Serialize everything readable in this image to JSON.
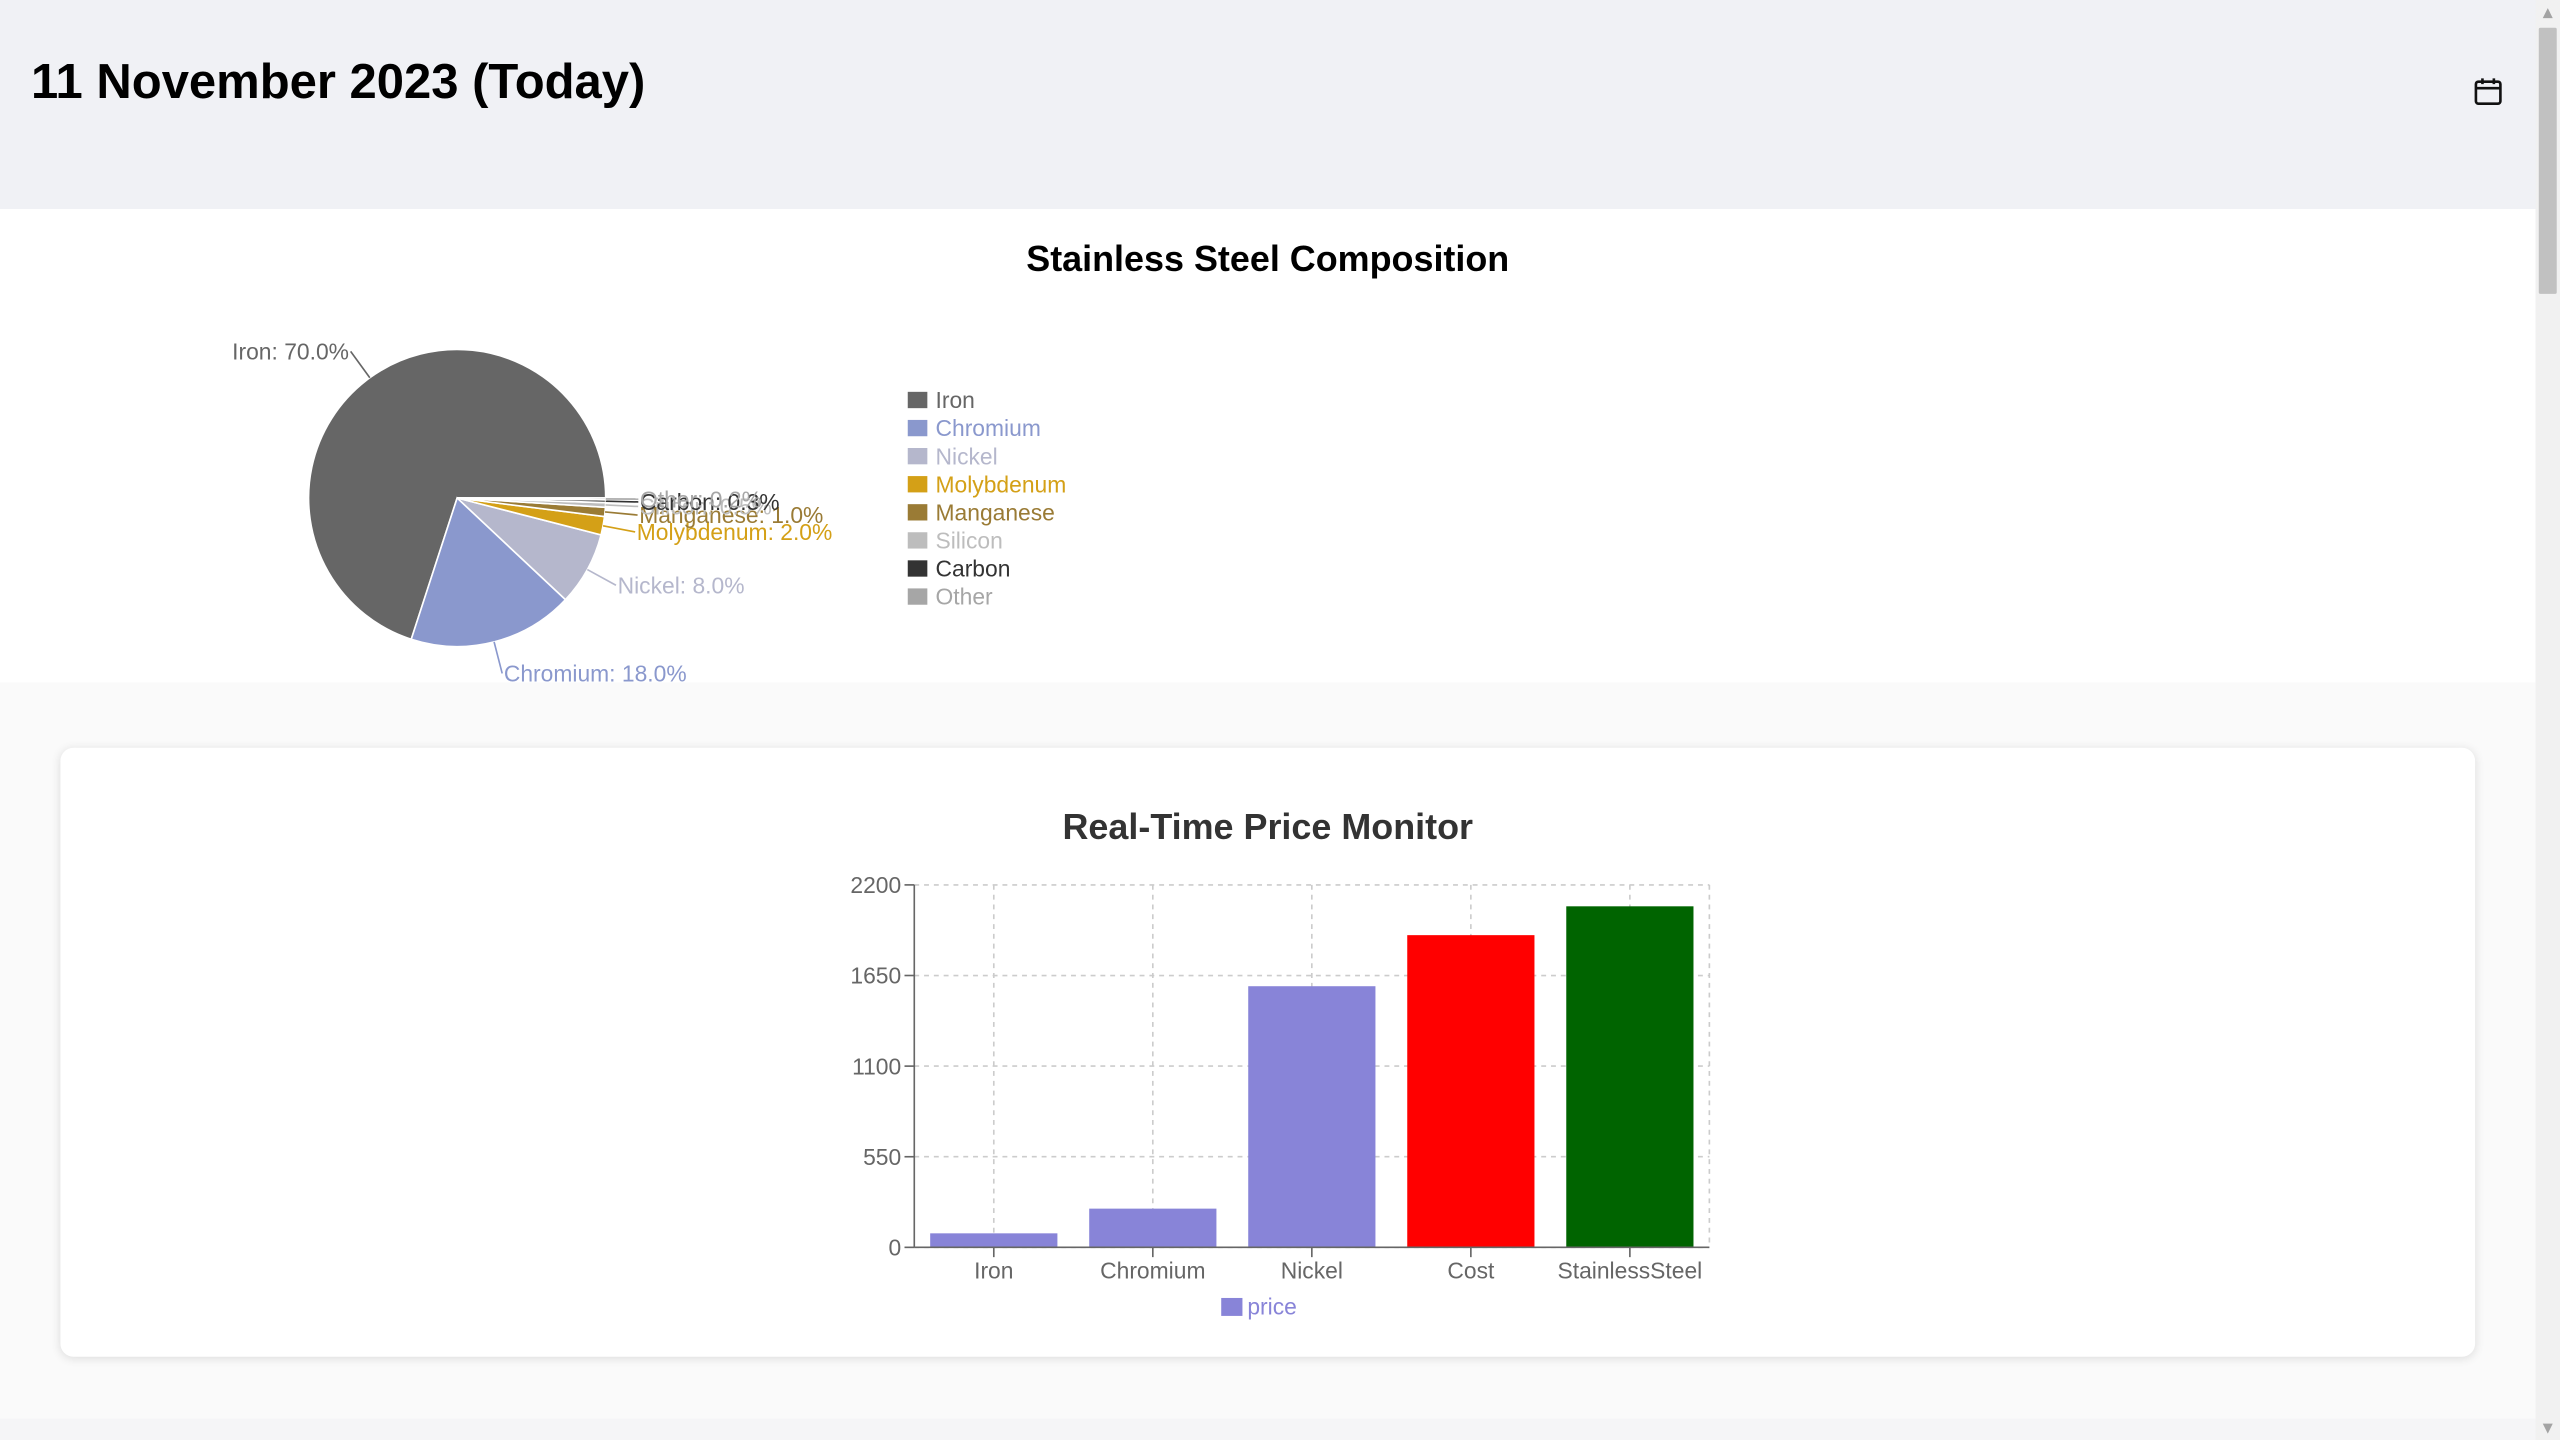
{
  "header": {
    "date_title": "11 November 2023 (Today)",
    "calendar_icon": "calendar-icon"
  },
  "composition": {
    "title": "Stainless Steel Composition"
  },
  "price_monitor": {
    "title": "Real-Time Price Monitor"
  },
  "chart_data": [
    {
      "type": "pie",
      "title": "Stainless Steel Composition",
      "slices": [
        {
          "name": "Iron",
          "value": 70.0,
          "label": "Iron: 70.0%",
          "color": "#666666"
        },
        {
          "name": "Chromium",
          "value": 18.0,
          "label": "Chromium: 18.0%",
          "color": "#8a98cd"
        },
        {
          "name": "Nickel",
          "value": 8.0,
          "label": "Nickel: 8.0%",
          "color": "#b5b7cc"
        },
        {
          "name": "Molybdenum",
          "value": 2.0,
          "label": "Molybdenum: 2.0%",
          "color": "#d4a017"
        },
        {
          "name": "Manganese",
          "value": 1.0,
          "label": "Manganese: 1.0%",
          "color": "#9a7b35"
        },
        {
          "name": "Silicon",
          "value": 0.5,
          "label": "Silicon: 0.5%",
          "color": "#bdbdbd"
        },
        {
          "name": "Carbon",
          "value": 0.3,
          "label": "Carbon: 0.3%",
          "color": "#333333"
        },
        {
          "name": "Other",
          "value": 0.2,
          "label": "Other: 0.2%",
          "color": "#a6a6a6"
        }
      ],
      "legend": [
        "Iron",
        "Chromium",
        "Nickel",
        "Molybdenum",
        "Manganese",
        "Silicon",
        "Carbon",
        "Other"
      ],
      "legend_position": "right"
    },
    {
      "type": "bar",
      "title": "Real-Time Price Monitor",
      "categories": [
        "Iron",
        "Chromium",
        "Nickel",
        "Cost",
        "StainlessSteel"
      ],
      "series": [
        {
          "name": "price",
          "values": [
            85,
            235,
            1585,
            1895,
            2070
          ],
          "color": "#8884d8"
        }
      ],
      "bar_colors": [
        "#8884d8",
        "#8884d8",
        "#8884d8",
        "#ff0000",
        "#006400"
      ],
      "yticks": [
        "0",
        "550",
        "1100",
        "1650",
        "2200"
      ],
      "ylim": [
        0,
        2200
      ],
      "grid": true,
      "legend_position": "bottom"
    }
  ]
}
